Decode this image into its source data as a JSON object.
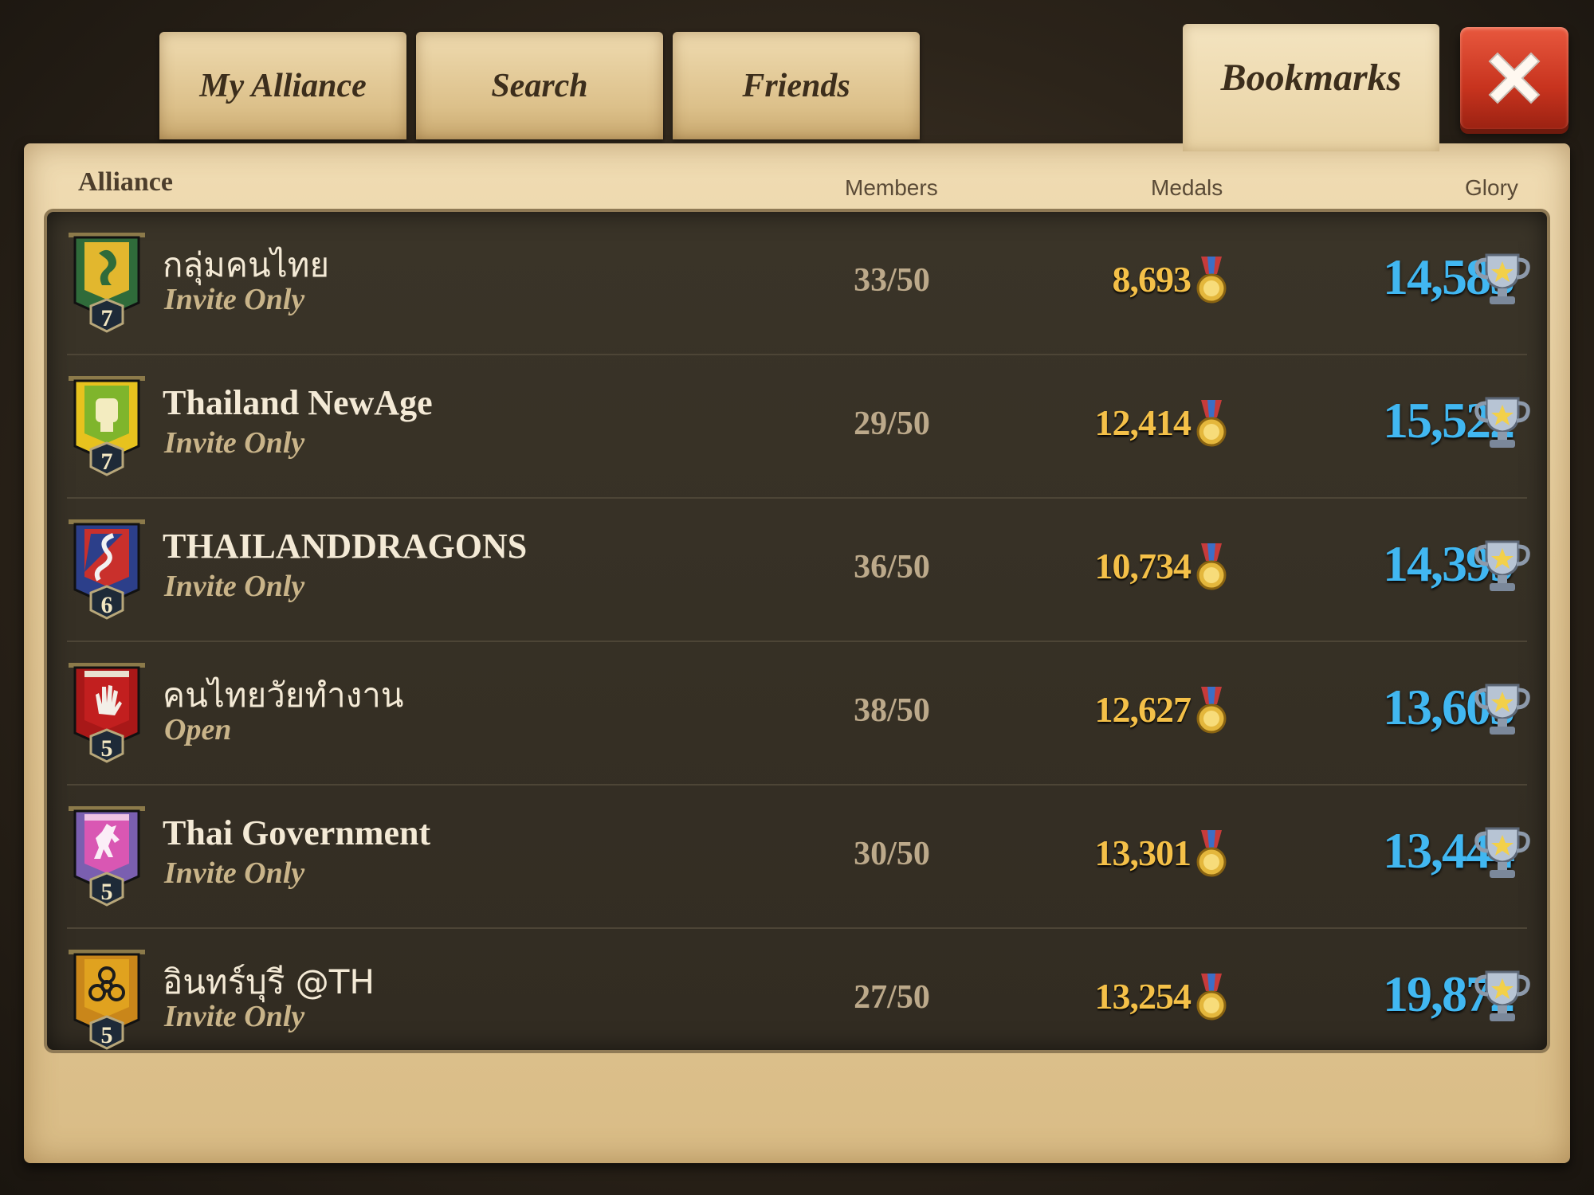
{
  "tabs": [
    {
      "label": "My Alliance",
      "active": false
    },
    {
      "label": "Search",
      "active": false
    },
    {
      "label": "Friends",
      "active": false
    },
    {
      "label": "Bookmarks",
      "active": true
    }
  ],
  "headers": {
    "alliance": "Alliance",
    "members": "Members",
    "medals": "Medals",
    "glory": "Glory"
  },
  "rows": [
    {
      "name": "กลุ่มคนไทย",
      "status": "Invite Only",
      "level": "7",
      "members": "33/50",
      "medals": "8,693",
      "glory": "14,585",
      "banner_color": "#2f6b3a",
      "emblem": "dragon-icon"
    },
    {
      "name": "Thailand NewAge",
      "status": "Invite Only",
      "level": "7",
      "members": "29/50",
      "medals": "12,414",
      "glory": "15,522",
      "banner_color": "#7fb52c",
      "emblem": "fist-icon"
    },
    {
      "name": "THAILANDDRAGONS",
      "status": "Invite Only",
      "level": "6",
      "members": "36/50",
      "medals": "10,734",
      "glory": "14,399",
      "banner_color": "#2c3f8a",
      "emblem": "dragon-icon"
    },
    {
      "name": "คนไทยวัยทำงาน",
      "status": "Open",
      "level": "5",
      "members": "38/50",
      "medals": "12,627",
      "glory": "13,605",
      "banner_color": "#c21f1f",
      "emblem": "hand-icon"
    },
    {
      "name": "Thai Government",
      "status": "Invite Only",
      "level": "5",
      "members": "30/50",
      "medals": "13,301",
      "glory": "13,444",
      "banner_color": "#d957b3",
      "emblem": "horse-icon"
    },
    {
      "name": "อินทร์บุรี @TH",
      "status": "Invite Only",
      "level": "5",
      "members": "27/50",
      "medals": "13,254",
      "glory": "19,872",
      "banner_color": "#e0a21f",
      "emblem": "biohazard-icon"
    }
  ],
  "colors": {
    "medals": "#f4c048",
    "glory": "#41b7f1",
    "close_button": "#d8452c"
  }
}
